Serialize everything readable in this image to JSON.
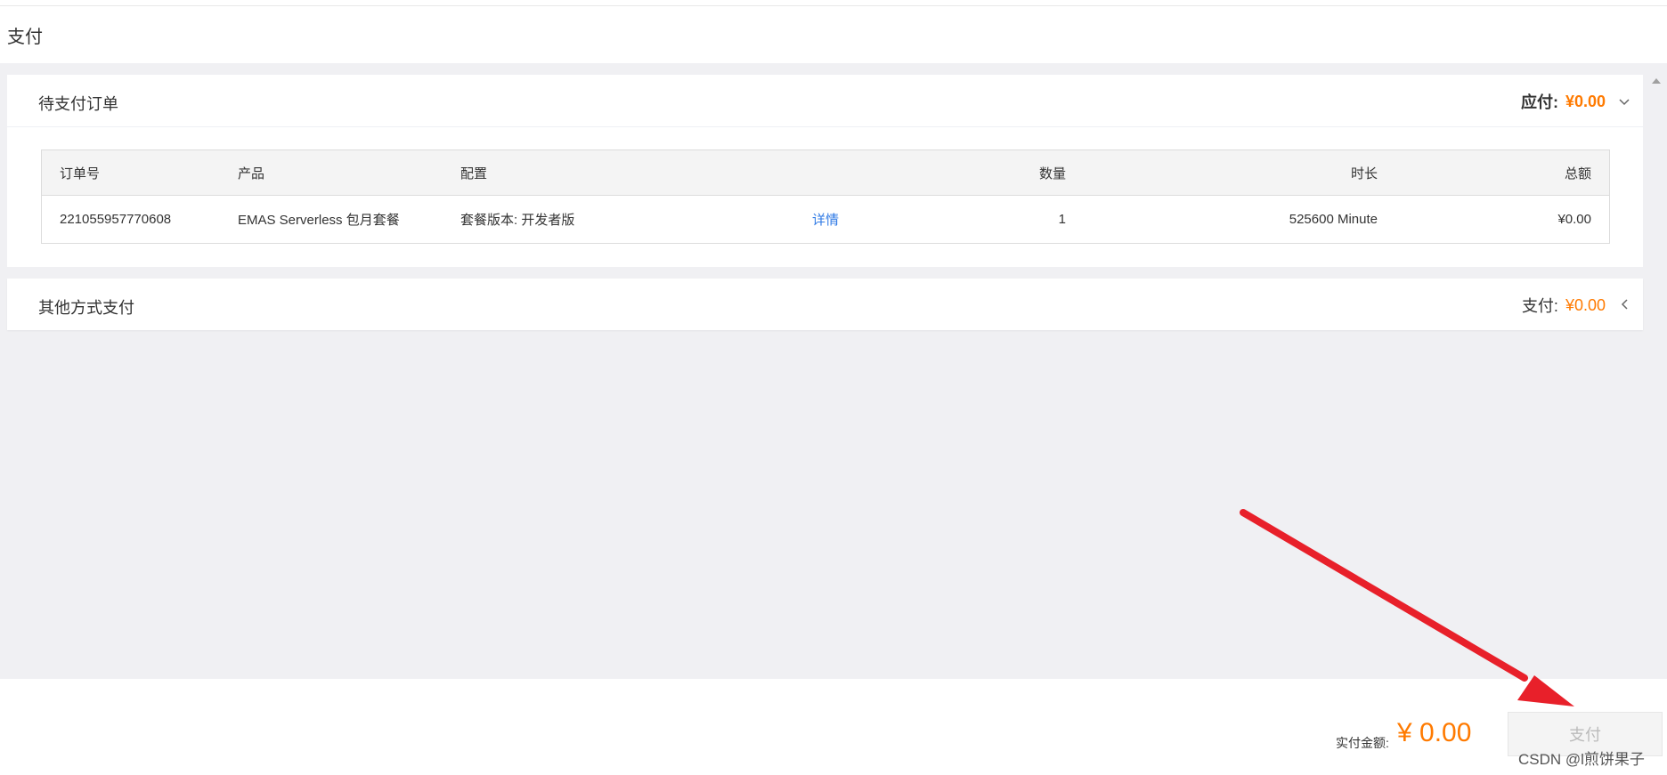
{
  "header": {
    "title": "支付"
  },
  "pending_orders": {
    "title": "待支付订单",
    "due_label": "应付:",
    "due_amount": "¥0.00",
    "table": {
      "columns": {
        "order_no": "订单号",
        "product": "产品",
        "config": "配置",
        "quantity": "数量",
        "duration": "时长",
        "total": "总额"
      },
      "rows": [
        {
          "order_no": "221055957770608",
          "product": "EMAS Serverless 包月套餐",
          "config": "套餐版本: 开发者版",
          "details_link": "详情",
          "quantity": "1",
          "duration": "525600 Minute",
          "total": "¥0.00"
        }
      ]
    }
  },
  "other_payment": {
    "title": "其他方式支付",
    "pay_label": "支付:",
    "pay_amount": "¥0.00"
  },
  "footer": {
    "actual_label": "实付金额:",
    "actual_amount": "¥ 0.00",
    "pay_button": "支付",
    "watermark": "CSDN @l煎饼果子"
  },
  "colors": {
    "accent_price": "#ff7a00",
    "link": "#2f7ae5",
    "annotation_arrow": "#e8202a"
  },
  "icons": {
    "pending_collapse": "chevron-down-icon",
    "other_expand": "chevron-left-icon",
    "scroll_up": "triangle-up-icon"
  }
}
